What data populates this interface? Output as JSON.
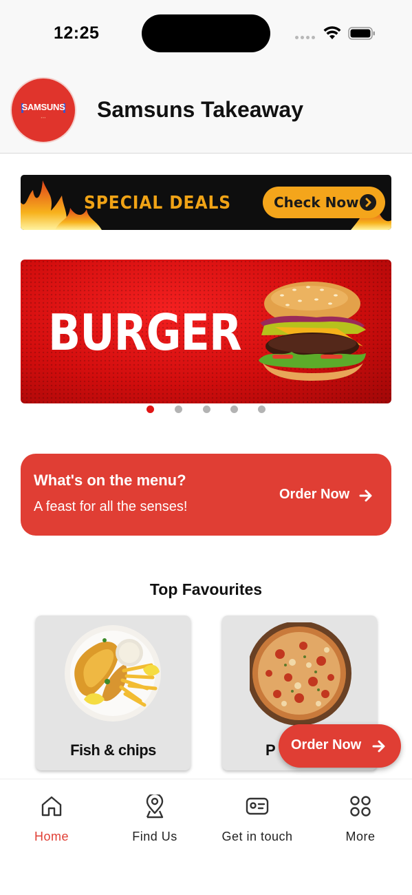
{
  "status_bar": {
    "time": "12:25"
  },
  "header": {
    "logo_text": "SAMSUNS",
    "title": "Samsuns Takeaway"
  },
  "deals_banner": {
    "title": "SPECIAL DEALS",
    "button_label": "Check Now"
  },
  "carousel": {
    "slide_title": "BURGER",
    "slide_count": 5,
    "active_index": 0
  },
  "menu_card": {
    "title": "What's on the menu?",
    "subtitle": "A feast for all the senses!",
    "order_label": "Order Now"
  },
  "favourites": {
    "heading": "Top Favourites",
    "items": [
      {
        "label": "Fish & chips"
      },
      {
        "label": "P"
      }
    ]
  },
  "fab": {
    "label": "Order Now"
  },
  "tabbar": {
    "items": [
      {
        "label": "Home",
        "icon": "home-icon",
        "active": true
      },
      {
        "label": "Find Us",
        "icon": "location-pin-icon",
        "active": false
      },
      {
        "label": "Get in touch",
        "icon": "contact-card-icon",
        "active": false
      },
      {
        "label": "More",
        "icon": "grid-icon",
        "active": false
      }
    ]
  },
  "colors": {
    "brand_red": "#e03e34",
    "deals_orange": "#f4a51b",
    "active_dot": "#e01515",
    "inactive_dot": "#b3b3b3"
  }
}
